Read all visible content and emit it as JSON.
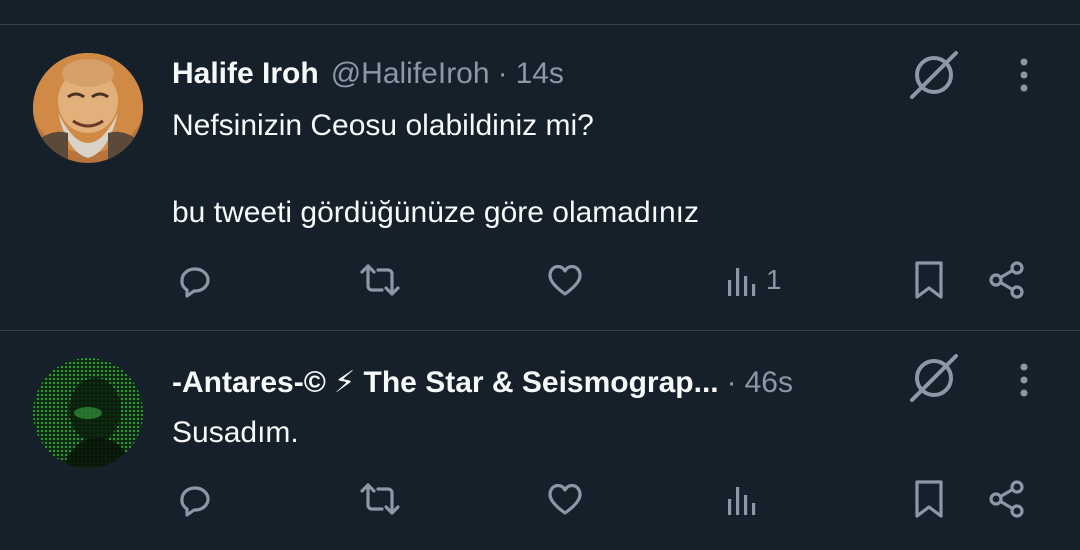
{
  "tweets": [
    {
      "display_name": "Halife Iroh",
      "handle": "@HalifeIroh",
      "separator": "·",
      "time": "14s",
      "text_line1": "Nefsinizin Ceosu olabildiniz mi?",
      "text_line2": "bu tweeti gördüğünüze göre olamadınız",
      "views": "1"
    },
    {
      "display_name": "-Antares-© ⚡ The Star & Seismograp...",
      "separator": "·",
      "time": "46s",
      "text_line1": "Susadım.",
      "views": ""
    }
  ],
  "colors": {
    "background": "#15202b",
    "divider": "#38444d",
    "primary_text": "#f7f9f9",
    "secondary_text": "#8b98a5"
  },
  "icons": {
    "reply": "reply-icon",
    "retweet": "retweet-icon",
    "like": "heart-icon",
    "views": "analytics-icon",
    "bookmark": "bookmark-icon",
    "share": "share-icon",
    "grok": "grok-icon",
    "more": "more-icon"
  }
}
